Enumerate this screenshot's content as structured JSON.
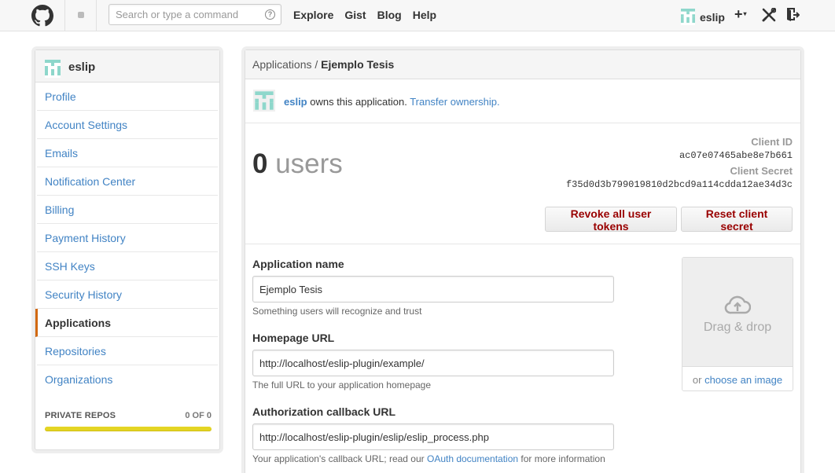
{
  "header": {
    "search_placeholder": "Search or type a command",
    "help_glyph": "?",
    "nav": [
      "Explore",
      "Gist",
      "Blog",
      "Help"
    ],
    "username": "eslip",
    "plus_glyph": "+",
    "caret_glyph": "▾",
    "icons": [
      "github-logo-icon",
      "notification-dot-icon",
      "tools-icon",
      "sign-out-icon"
    ]
  },
  "sidebar": {
    "username": "eslip",
    "items": [
      {
        "label": "Profile",
        "active": false
      },
      {
        "label": "Account Settings",
        "active": false
      },
      {
        "label": "Emails",
        "active": false
      },
      {
        "label": "Notification Center",
        "active": false
      },
      {
        "label": "Billing",
        "active": false
      },
      {
        "label": "Payment History",
        "active": false
      },
      {
        "label": "SSH Keys",
        "active": false
      },
      {
        "label": "Security History",
        "active": false
      },
      {
        "label": "Applications",
        "active": true
      },
      {
        "label": "Repositories",
        "active": false
      },
      {
        "label": "Organizations",
        "active": false
      }
    ],
    "private_repos": {
      "label": "PRIVATE REPOS",
      "count": "0 OF 0",
      "usage_fraction": 0
    }
  },
  "main": {
    "breadcrumb_parent": "Applications",
    "breadcrumb_sep": " / ",
    "breadcrumb_current": "Ejemplo Tesis",
    "owner_name": "eslip",
    "owner_text": " owns this application. ",
    "transfer_link": "Transfer ownership.",
    "users_count": "0",
    "users_label": " users",
    "client_id_label": "Client ID",
    "client_id": "ac07e07465abe8e7b661",
    "client_secret_label": "Client Secret",
    "client_secret": "f35d0d3b799019810d2bcd9a114cdda12ae34d3c",
    "revoke_label": "Revoke all user tokens",
    "reset_label": "Reset client secret",
    "form": {
      "app_name_label": "Application name",
      "app_name_value": "Ejemplo Tesis",
      "app_name_note": "Something users will recognize and trust",
      "homepage_label": "Homepage URL",
      "homepage_value": "http://localhost/eslip-plugin/example/",
      "homepage_note": "The full URL to your application homepage",
      "callback_label": "Authorization callback URL",
      "callback_value": "http://localhost/eslip-plugin/eslip/eslip_process.php",
      "callback_note_pre": "Your application's callback URL; read our ",
      "callback_note_link": "OAuth documentation",
      "callback_note_post": " for more information"
    },
    "dropzone": {
      "label": "Drag & drop",
      "choose_pre": "or ",
      "choose_link": "choose an image"
    }
  },
  "colors": {
    "link": "#4183c4",
    "danger_text": "#990000",
    "active_marker": "#d26911",
    "identicon": "#8ed7cb",
    "quota_bar": "#e4d524"
  }
}
